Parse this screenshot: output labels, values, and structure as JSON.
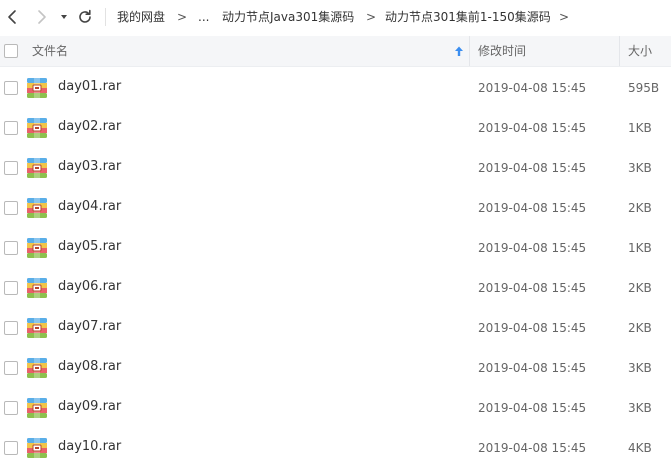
{
  "breadcrumb": {
    "root": "我的网盘",
    "ellipsis": "...",
    "level1": "动力节点Java301集源码",
    "level2": "动力节点301集前1-150集源码",
    "separator": ">"
  },
  "header": {
    "name": "文件名",
    "modified": "修改时间",
    "size": "大小"
  },
  "colors": {
    "header_bg": "#f5f6f8",
    "sort_arrow": "#3b8ef0",
    "rar_stripes": [
      "#5aaee8",
      "#f1c54a",
      "#e9606a",
      "#8cc04e"
    ]
  },
  "icons": {
    "back": "chevron-left-icon",
    "forward": "chevron-right-icon",
    "history": "caret-down-icon",
    "refresh": "refresh-icon",
    "sort": "sort-ascending-icon",
    "file": "rar-archive-icon"
  },
  "files": [
    {
      "name": "day01.rar",
      "modified": "2019-04-08 15:45",
      "size": "595B"
    },
    {
      "name": "day02.rar",
      "modified": "2019-04-08 15:45",
      "size": "1KB"
    },
    {
      "name": "day03.rar",
      "modified": "2019-04-08 15:45",
      "size": "3KB"
    },
    {
      "name": "day04.rar",
      "modified": "2019-04-08 15:45",
      "size": "2KB"
    },
    {
      "name": "day05.rar",
      "modified": "2019-04-08 15:45",
      "size": "1KB"
    },
    {
      "name": "day06.rar",
      "modified": "2019-04-08 15:45",
      "size": "2KB"
    },
    {
      "name": "day07.rar",
      "modified": "2019-04-08 15:45",
      "size": "2KB"
    },
    {
      "name": "day08.rar",
      "modified": "2019-04-08 15:45",
      "size": "3KB"
    },
    {
      "name": "day09.rar",
      "modified": "2019-04-08 15:45",
      "size": "3KB"
    },
    {
      "name": "day10.rar",
      "modified": "2019-04-08 15:45",
      "size": "4KB"
    }
  ]
}
